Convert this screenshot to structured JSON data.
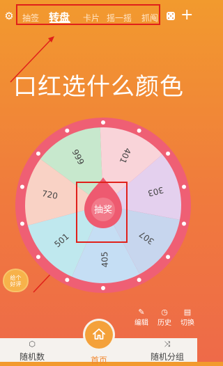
{
  "header": {
    "settings_icon": "gear-icon",
    "tabs": [
      {
        "label": "抽签",
        "active": false
      },
      {
        "label": "转盘",
        "active": true
      },
      {
        "label": "卡片",
        "active": false
      },
      {
        "label": "摇一摇",
        "active": false
      },
      {
        "label": "抓阄",
        "active": false
      }
    ],
    "dice_icon": "dice-icon",
    "add_label": "+"
  },
  "title": "口红选什么颜色",
  "wheel": {
    "center_label": "抽奖",
    "segments": [
      {
        "label": "720",
        "color": "#f9d2c5"
      },
      {
        "label": "999",
        "color": "#c7e8cd"
      },
      {
        "label": "401",
        "color": "#f9d4d9"
      },
      {
        "label": "303",
        "color": "#e4d0ee"
      },
      {
        "label": "307",
        "color": "#c7d6ee"
      },
      {
        "label": "405",
        "color": "#c5def4"
      },
      {
        "label": "501",
        "color": "#bfe8ee"
      }
    ],
    "ring_color": "#ef5f74"
  },
  "rate": {
    "text_line1": "给个",
    "text_line2": "好评"
  },
  "tools": [
    {
      "label": "编辑",
      "icon": "pencil-icon"
    },
    {
      "label": "历史",
      "icon": "clock-icon"
    },
    {
      "label": "切换",
      "icon": "switch-icon"
    }
  ],
  "bottom_nav": [
    {
      "label": "随机数",
      "icon": "cube-icon"
    },
    {
      "label": "首页",
      "icon": "home-icon",
      "active": true
    },
    {
      "label": "随机分组",
      "icon": "shuffle-icon"
    }
  ]
}
